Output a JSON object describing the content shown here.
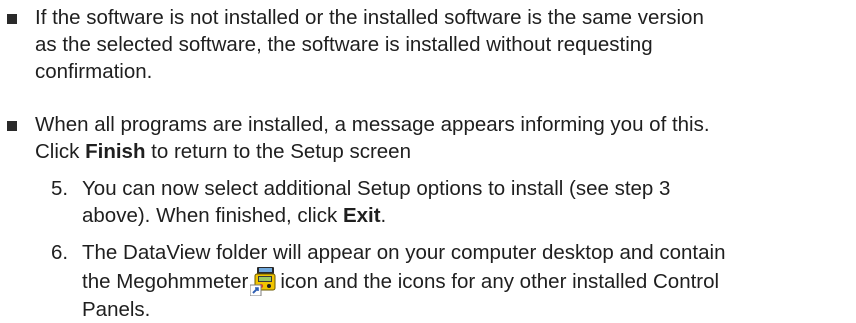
{
  "bullets": [
    {
      "lines": [
        "If the software is not installed or the installed software is the same version",
        "as the selected software, the software is installed without requesting",
        "confirmation."
      ]
    },
    {
      "line1": "When all programs are installed, a message appears informing you of this.",
      "line2_prefix": "Click ",
      "line2_bold": "Finish",
      "line2_suffix": " to return to the Setup screen"
    }
  ],
  "steps": [
    {
      "number": "5.",
      "line1": "You can now select additional Setup options to install (see step 3",
      "line2_prefix": "above). When finished, click ",
      "line2_bold": "Exit",
      "line2_suffix": "."
    },
    {
      "number": "6.",
      "line1": "The DataView folder will appear on your computer desktop and contain",
      "line2_prefix": "the Megohmmeter",
      "line2_suffix": "icon and the icons for any other installed Control",
      "line3": "Panels.",
      "icon": "megohmmeter-icon"
    }
  ]
}
